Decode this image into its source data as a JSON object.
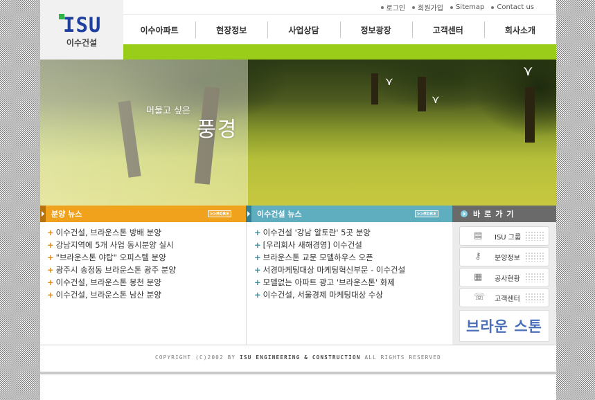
{
  "header": {
    "logo_text": "ISU",
    "company_name": "이수건설",
    "utility_links": [
      "로그인",
      "회원가입",
      "Sitemap",
      "Contact us"
    ],
    "nav": [
      "이수아파트",
      "현장정보",
      "사업상담",
      "정보광장",
      "고객센터",
      "회사소개"
    ]
  },
  "hero": {
    "small_text": "머물고 싶은",
    "big_text": "풍경"
  },
  "sections": {
    "sales_news": {
      "title": "분양 뉴스",
      "more": ">>MORE",
      "items": [
        "이수건설, 브라운스톤 방배 분양",
        "강남지역에 5개 사업 동시분양 실시",
        "\"브라운스톤 야탑\" 오피스텔 분양",
        "광주시 송정동 브라운스톤 광주 분양",
        "이수건설, 브라운스톤 봉천 분양",
        "이수건설, 브라운스톤 남산 분양"
      ]
    },
    "company_news": {
      "title": "이수건설 뉴스",
      "more": ">>MORE",
      "items": [
        "이수건설 '강남 알토란' 5곳 분양",
        "[우리회사 새해경영] 이수건설",
        "브라운스톤 교문 모델하우스 오픈",
        "서경마케팅대상 마케팅혁신부문 - 이수건설",
        "모델없는 아파트 광고 '브라운스톤' 화제",
        "이수건설, 서울경제 마케팅대상 수상"
      ]
    },
    "shortcuts": {
      "title": "바로가기",
      "items": [
        {
          "label": "ISU 그룹",
          "icon": "building-icon"
        },
        {
          "label": "분양정보",
          "icon": "key-icon"
        },
        {
          "label": "공사현황",
          "icon": "construction-icon"
        },
        {
          "label": "고객센터",
          "icon": "phone-icon"
        }
      ],
      "brand": "브라운 스톤"
    }
  },
  "footer": {
    "prefix": "COPYRIGHT (C)2002 BY",
    "company": "ISU ENGINEERING & CONSTRUCTION",
    "suffix": "ALL RIGHTS RESERVED"
  },
  "colors": {
    "accent_green": "#9acd1a",
    "sales_orange": "#f0a21d",
    "news_teal": "#5faec0",
    "shortcut_gray": "#6a6a6a",
    "logo_blue": "#1d3fa0"
  }
}
